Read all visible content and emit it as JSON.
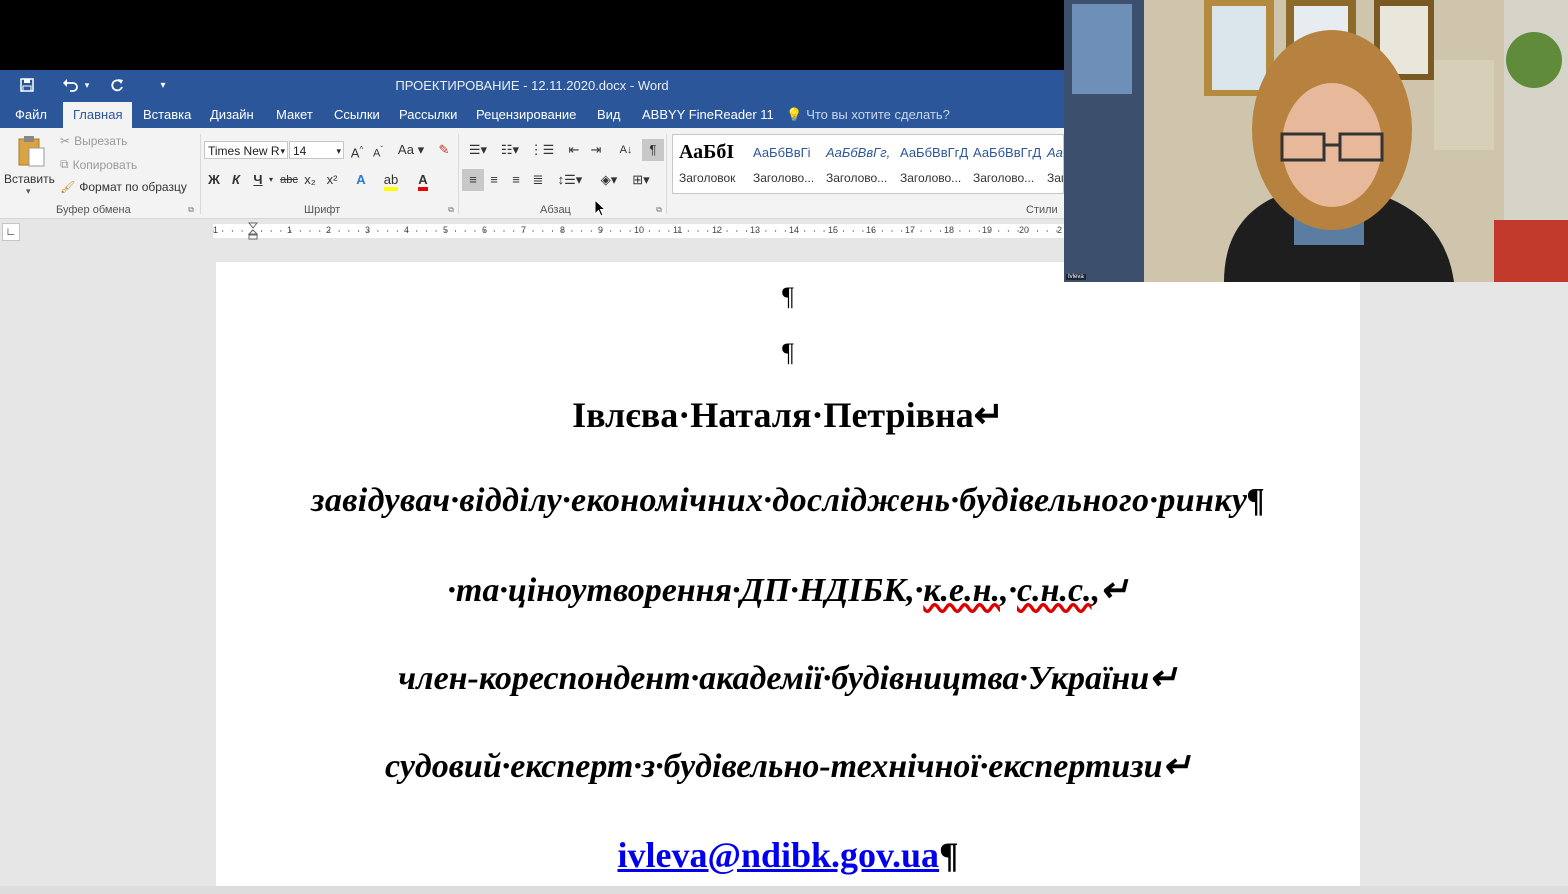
{
  "window": {
    "title": "ПРОЕКТИРОВАНИЕ - 12.11.2020.docx - Word"
  },
  "quick_access": {
    "save_icon": "save-icon",
    "undo_icon": "undo-icon",
    "redo_icon": "redo-icon",
    "customize_icon": "customize-icon"
  },
  "tabs": [
    {
      "label": "Файл"
    },
    {
      "label": "Главная"
    },
    {
      "label": "Вставка"
    },
    {
      "label": "Дизайн"
    },
    {
      "label": "Макет"
    },
    {
      "label": "Ссылки"
    },
    {
      "label": "Рассылки"
    },
    {
      "label": "Рецензирование"
    },
    {
      "label": "Вид"
    },
    {
      "label": "ABBYY FineReader 11"
    },
    {
      "label": "Что вы хотите сделать?"
    }
  ],
  "clipboard": {
    "paste": "Вставить",
    "cut": "Вырезать",
    "copy": "Копировать",
    "format_painter": "Формат по образцу",
    "group_label": "Буфер обмена"
  },
  "font": {
    "name": "Times New R",
    "size": "14",
    "group_label": "Шрифт",
    "case_label": "Аа",
    "bold": "Ж",
    "italic": "К",
    "underline": "Ч",
    "strike": "abc",
    "sub": "x₂",
    "sup": "x²"
  },
  "paragraph": {
    "group_label": "Абзац"
  },
  "styles": {
    "group_label": "Стили",
    "items": [
      {
        "sample": "АаБбІ",
        "name": "Заголовок"
      },
      {
        "sample": "АаБбВвГі",
        "name": "Заголово..."
      },
      {
        "sample": "АаБбВвГг,",
        "name": "Заголово..."
      },
      {
        "sample": "АаБбВвГгД",
        "name": "Заголово..."
      },
      {
        "sample": "АаБбВвГгД",
        "name": "Заголово..."
      },
      {
        "sample": "Аа",
        "name": "Заг"
      }
    ]
  },
  "ruler": {
    "numbers": [
      "1",
      "1",
      "2",
      "3",
      "4",
      "5",
      "6",
      "7",
      "8",
      "9",
      "10",
      "11",
      "12",
      "13",
      "14",
      "15",
      "16",
      "17",
      "18",
      "19",
      "20",
      "2"
    ]
  },
  "document": {
    "pilcrow1": "¶",
    "pilcrow2": "¶",
    "name_line": "Івлєва·Наталя·Петрівна↵",
    "line1": "завідувач·відділу·економічних·досліджень·будівельного·ринку¶",
    "line2_a": "·та·ціноутворення·ДП·НДІБК,·",
    "line2_b": "к.е.н.",
    "line2_c": ",·",
    "line2_d": "с.н.с.",
    "line2_e": ",↵",
    "line3": "член-кореспондент·академії·будівництва·України↵",
    "line4": "судовий·експерт·з·будівельно-технічної·експертизи↵",
    "email": "ivleva@ndibk.gov.ua",
    "email_pilcrow": "¶"
  },
  "video": {
    "participant_label": "Ivleva"
  }
}
